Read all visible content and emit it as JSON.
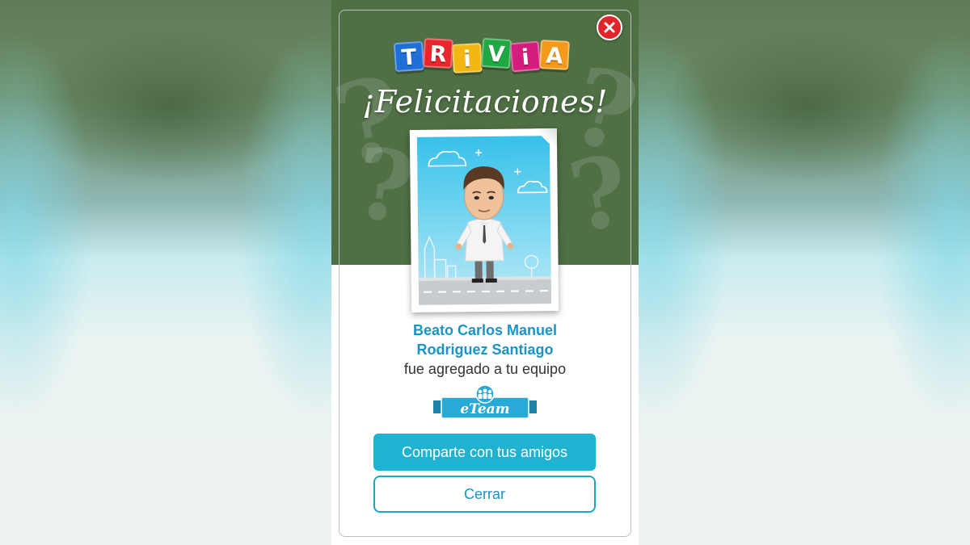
{
  "dialog": {
    "logo_letters": [
      "T",
      "R",
      "i",
      "V",
      "i",
      "A"
    ],
    "logo_colors": [
      "#1e6fd8",
      "#e8262b",
      "#f3b714",
      "#21a842",
      "#d31c7c",
      "#f39a1d"
    ],
    "headline": "¡Felicitaciones!",
    "character_name_line1": "Beato Carlos Manuel",
    "character_name_line2": "Rodriguez Santiago",
    "added_message": "fue agregado a tu equipo",
    "badge_label": "eTeam",
    "share_button_label": "Comparte con tus amigos",
    "close_button_label": "Cerrar",
    "close_icon": "close-icon"
  },
  "colors": {
    "header_green": "#4f6f45",
    "accent_blue": "#1fb3d1",
    "name_blue": "#1a93c7",
    "close_red": "#e0252d"
  }
}
